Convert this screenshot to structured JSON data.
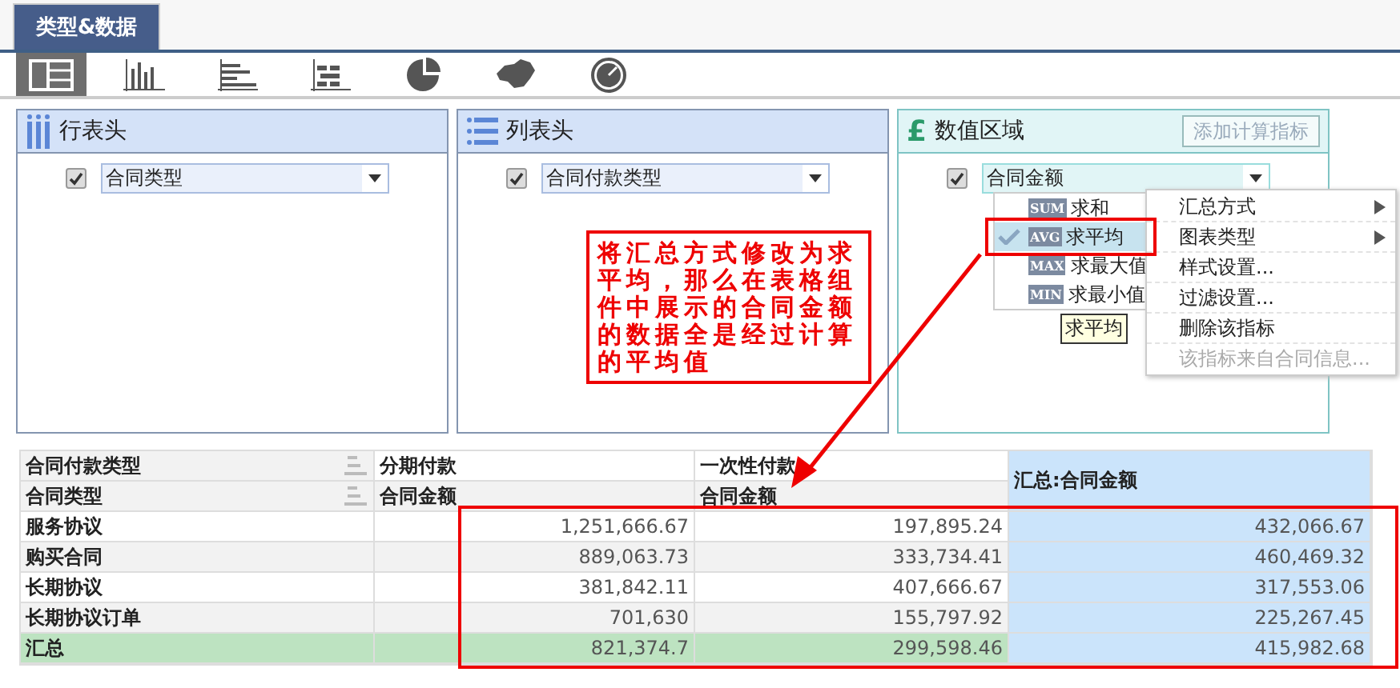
{
  "tabs": [
    {
      "label": "类型&数据",
      "selected": true
    }
  ],
  "chart_types": [
    {
      "kind": "table",
      "selected": true
    },
    {
      "kind": "column",
      "selected": false
    },
    {
      "kind": "bar",
      "selected": false
    },
    {
      "kind": "stacked",
      "selected": false
    },
    {
      "kind": "pie",
      "selected": false
    },
    {
      "kind": "map",
      "selected": false
    },
    {
      "kind": "gauge",
      "selected": false
    }
  ],
  "panels": [
    {
      "kind": "rows",
      "title": "行表头",
      "fields": [
        {
          "label": "合同类型",
          "checked": true
        }
      ]
    },
    {
      "kind": "columns",
      "title": "列表头",
      "fields": [
        {
          "label": "合同付款类型",
          "checked": true
        }
      ]
    },
    {
      "kind": "values",
      "icon": "£",
      "title": "数值区域",
      "button": "添加计算指标",
      "fields": [
        {
          "label": "合同金额",
          "checked": true
        }
      ]
    }
  ],
  "aggregate_menu": [
    {
      "badge": "SUM",
      "label": "求和",
      "selected": false
    },
    {
      "badge": "AVG",
      "label": "求平均",
      "selected": true
    },
    {
      "badge": "MAX",
      "label": "求最大值",
      "selected": false
    },
    {
      "badge": "MIN",
      "label": "求最小值",
      "selected": false
    }
  ],
  "tooltip": "求平均",
  "context_menu": [
    {
      "label": "汇总方式",
      "submenu": true,
      "disabled": false
    },
    {
      "label": "图表类型",
      "submenu": true,
      "disabled": false
    },
    {
      "label": "样式设置...",
      "submenu": false,
      "disabled": false
    },
    {
      "label": "过滤设置...",
      "submenu": false,
      "disabled": false
    },
    {
      "label": "删除该指标",
      "submenu": false,
      "disabled": false
    },
    {
      "label": "该指标来自合同信息...",
      "submenu": false,
      "disabled": true
    }
  ],
  "annotation": "将汇总方式修改为求平均，那么在表格组件中展示的合同金额的数据全是经过计算的平均值",
  "table": {
    "header_rows": [
      {
        "label": "合同付款类型",
        "cells": [
          "分期付款",
          "一次性付款"
        ]
      },
      {
        "label": "合同类型",
        "cells": [
          "合同金额",
          "合同金额"
        ]
      }
    ],
    "total_header": "汇总:合同金额",
    "rows": [
      {
        "kind": "data",
        "label": "服务协议",
        "values": [
          "1,251,666.67",
          "197,895.24"
        ],
        "total": "432,066.67"
      },
      {
        "kind": "data",
        "label": "购买合同",
        "values": [
          "889,063.73",
          "333,734.41"
        ],
        "total": "460,469.32"
      },
      {
        "kind": "data",
        "label": "长期协议",
        "values": [
          "381,842.11",
          "407,666.67"
        ],
        "total": "317,553.06"
      },
      {
        "kind": "data",
        "label": "长期协议订单",
        "values": [
          "701,630",
          "155,797.92"
        ],
        "total": "225,267.45"
      },
      {
        "kind": "total",
        "label": "汇总",
        "values": [
          "821,374.7",
          "299,598.46"
        ],
        "total": "415,982.68"
      }
    ]
  }
}
